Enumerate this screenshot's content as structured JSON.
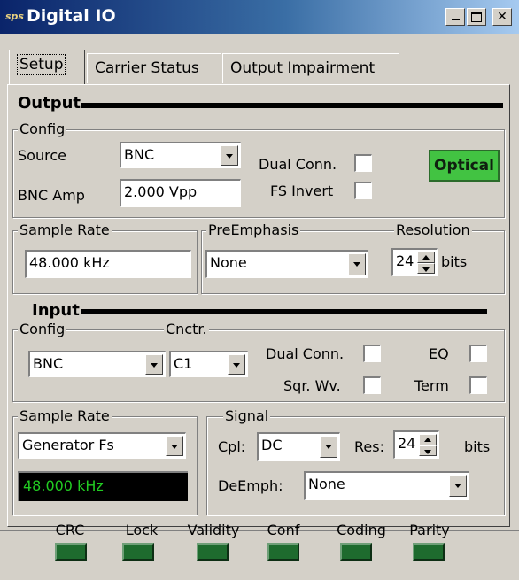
{
  "window": {
    "title": "Digital IO",
    "icon": "sps-logo-icon",
    "icon_text": "sps"
  },
  "tabs": [
    {
      "label": "Setup",
      "active": true
    },
    {
      "label": "Carrier Status",
      "active": false
    },
    {
      "label": "Output Impairment",
      "active": false
    }
  ],
  "output": {
    "header": "Output",
    "config": {
      "label": "Config",
      "source_label": "Source",
      "source_value": "BNC",
      "dual_conn_label": "Dual Conn.",
      "dual_conn_checked": false,
      "bnc_amp_label": "BNC Amp",
      "bnc_amp_value": "2.000 Vpp",
      "fs_invert_label": "FS Invert",
      "fs_invert_checked": false,
      "optical_label": "Optical",
      "optical_color": "#42c342"
    },
    "sample_rate": {
      "label": "Sample Rate",
      "value": "48.000 kHz"
    },
    "preemphasis": {
      "label": "PreEmphasis",
      "value": "None"
    },
    "resolution": {
      "label": "Resolution",
      "value": "24",
      "unit": "bits"
    }
  },
  "input": {
    "header": "Input",
    "config": {
      "label": "Config",
      "connector_label": "Cnctr.",
      "source_value": "BNC",
      "connector_value": "C1",
      "dual_conn_label": "Dual Conn.",
      "eq_label": "EQ",
      "sqr_wv_label": "Sqr. Wv.",
      "term_label": "Term"
    },
    "sample_rate": {
      "label": "Sample Rate",
      "source_value": "Generator Fs",
      "display_value": "48.000 kHz"
    },
    "signal": {
      "label": "Signal",
      "cpl_label": "Cpl:",
      "cpl_value": "DC",
      "res_label": "Res:",
      "res_value": "24",
      "res_unit": "bits",
      "deemph_label": "DeEmph:",
      "deemph_value": "None"
    }
  },
  "status": [
    {
      "label": "CRC"
    },
    {
      "label": "Lock"
    },
    {
      "label": "Validity"
    },
    {
      "label": "Conf"
    },
    {
      "label": "Coding"
    },
    {
      "label": "Parity"
    }
  ],
  "colors": {
    "led": "#1e6b2e",
    "display_text": "#22cc22",
    "titlebar": "#0a246a"
  }
}
